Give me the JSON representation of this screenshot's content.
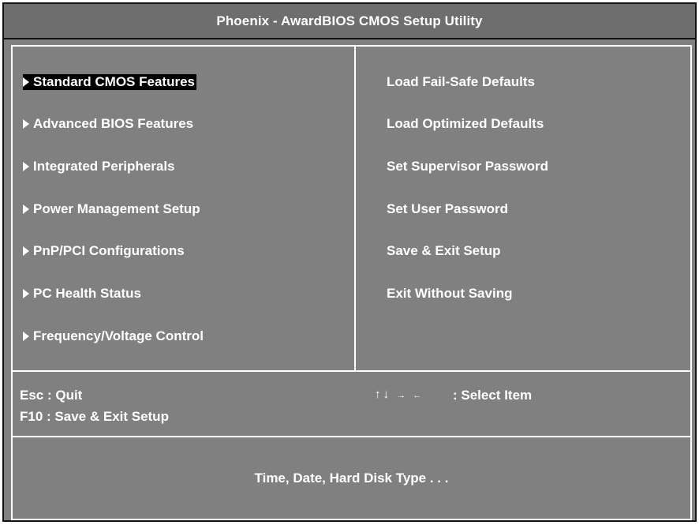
{
  "title": "Phoenix - AwardBIOS CMOS Setup Utility",
  "left_menu": [
    {
      "label": "Standard CMOS Features",
      "selected": true
    },
    {
      "label": "Advanced BIOS Features",
      "selected": false
    },
    {
      "label": "Integrated Peripherals",
      "selected": false
    },
    {
      "label": "Power Management Setup",
      "selected": false
    },
    {
      "label": "PnP/PCI Configurations",
      "selected": false
    },
    {
      "label": "PC Health Status",
      "selected": false
    },
    {
      "label": "Frequency/Voltage Control",
      "selected": false
    }
  ],
  "right_menu": [
    {
      "label": "Load Fail-Safe Defaults"
    },
    {
      "label": "Load Optimized Defaults"
    },
    {
      "label": "Set Supervisor Password"
    },
    {
      "label": "Set User Password"
    },
    {
      "label": "Save & Exit Setup"
    },
    {
      "label": "Exit Without Saving"
    }
  ],
  "help": {
    "esc": "Esc : Quit",
    "f10": "F10 : Save & Exit Setup",
    "arrows_vertical": "↑↓",
    "arrows_horizontal": "→ ←",
    "select_item": ": Select Item"
  },
  "description": "Time, Date, Hard Disk Type . . .",
  "colors": {
    "background": "#808080",
    "title_background": "#6e6e6e",
    "text": "#ffffff",
    "selection_background": "#000000"
  },
  "icons": {
    "submenu_marker": "triangle-right-icon",
    "navigation_keys": "arrow-keys-icon"
  }
}
